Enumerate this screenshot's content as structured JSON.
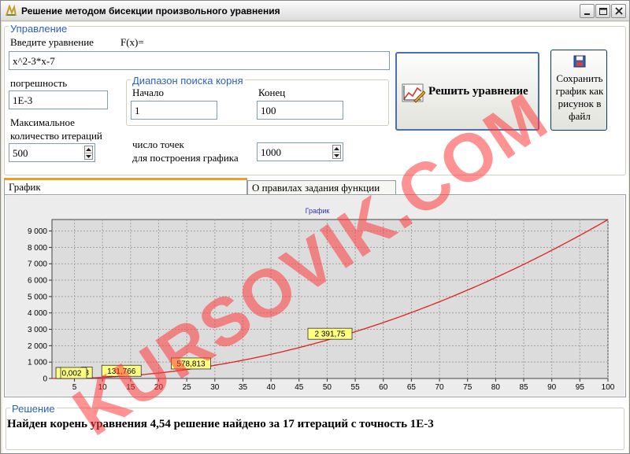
{
  "window": {
    "title": "Решение методом бисекции произвольного уравнения"
  },
  "controls": {
    "group_title": "Управление",
    "equation_label": "Введите уравнение",
    "fx_label": "F(x)=",
    "equation_value": "x^2-3*x-7",
    "tolerance_label": "погрешность",
    "tolerance_value": "1E-3",
    "max_iter_label_1": "Максимальное",
    "max_iter_label_2": "количество итераций",
    "max_iter_value": "500",
    "range_group_title": "Диапазон поиска корня",
    "start_label": "Начало",
    "start_value": "1",
    "end_label": "Конец",
    "end_value": "100",
    "points_label_1": "число точек",
    "points_label_2": "для построения графика",
    "points_value": "1000",
    "solve_button": "Решить уравнение",
    "save_button_lines": [
      "Сохранить",
      "график как",
      "рисунок в",
      "файл"
    ]
  },
  "tabs": [
    {
      "label": "График",
      "active": true
    },
    {
      "label": "О правилах задания функции",
      "active": false
    }
  ],
  "chart_data": {
    "type": "line",
    "title": "График",
    "xlim": [
      1,
      100
    ],
    "ylim": [
      0,
      9700
    ],
    "xticks": [
      5,
      10,
      15,
      20,
      25,
      30,
      35,
      40,
      45,
      50,
      55,
      60,
      65,
      70,
      75,
      80,
      85,
      90,
      95,
      100
    ],
    "yticks": [
      0,
      1000,
      2000,
      3000,
      4000,
      5000,
      6000,
      7000,
      8000,
      9000
    ],
    "ytick_labels": [
      "0",
      "1 000",
      "2 000",
      "3 000",
      "4 000",
      "5 000",
      "6 000",
      "7 000",
      "8 000",
      "9 000"
    ],
    "series": [
      {
        "function": "x^2-3*x-7",
        "color": "#e02020"
      }
    ],
    "annotations": [
      {
        "x": 50.5,
        "y": 2391.75,
        "label": "2 391,75"
      },
      {
        "x": 25.75,
        "y": 578.813,
        "label": "578,813"
      },
      {
        "x": 13.375,
        "y": 131.766,
        "label": "131,766"
      },
      {
        "x": 7.1875,
        "y": 22.1,
        "label": "8"
      },
      {
        "x": 4.5,
        "y": 0.002,
        "label": "0,002"
      },
      {
        "x": 2.55,
        "y": -7,
        "label": ""
      }
    ],
    "grid": true,
    "grid_color": "#a0a0a0",
    "label_bg": "#ffff80"
  },
  "result": {
    "group_title": "Решение",
    "text": "Найден корень уравнения 4,54 решение найдено за 17 итераций с точность 1E-3"
  },
  "watermark": "KURSOVIK.COM",
  "colors": {
    "accent_blue": "#2b5fc1",
    "watermark": "#ff3b3b"
  }
}
